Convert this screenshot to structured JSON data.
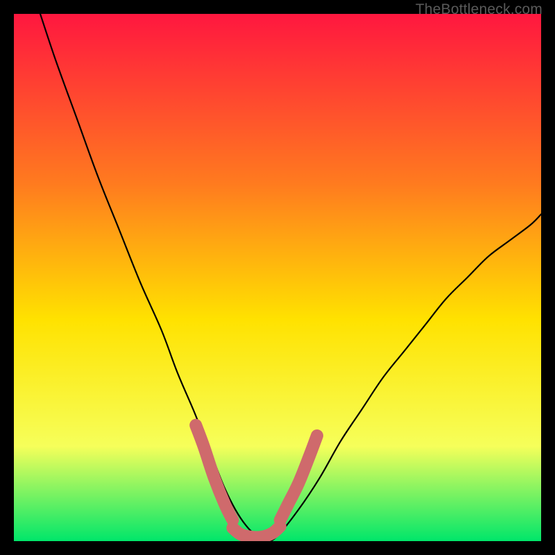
{
  "watermark": "TheBottleneck.com",
  "colors": {
    "frame": "#000000",
    "gradient_top": "#ff173f",
    "gradient_mid1": "#ff7a1f",
    "gradient_mid2": "#ffe200",
    "gradient_mid3": "#f6ff5a",
    "gradient_bottom": "#00e66a",
    "curve": "#000000",
    "highlight": "#cf6a6c"
  },
  "chart_data": {
    "type": "line",
    "title": "",
    "xlabel": "",
    "ylabel": "",
    "xlim": [
      0,
      100
    ],
    "ylim": [
      0,
      100
    ],
    "series": [
      {
        "name": "bottleneck-curve",
        "x": [
          5,
          8,
          12,
          16,
          20,
          24,
          28,
          31,
          34,
          36,
          38,
          40,
          42,
          44,
          46,
          48,
          50,
          54,
          58,
          62,
          66,
          70,
          74,
          78,
          82,
          86,
          90,
          94,
          98,
          100
        ],
        "y": [
          100,
          91,
          80,
          69,
          59,
          49,
          40,
          32,
          25,
          20,
          15,
          10,
          6,
          3,
          1,
          0,
          1,
          6,
          12,
          19,
          25,
          31,
          36,
          41,
          46,
          50,
          54,
          57,
          60,
          62
        ]
      }
    ],
    "highlight_segments": [
      {
        "name": "left-arm",
        "x": [
          34.5,
          36,
          38,
          40,
          41.5
        ],
        "y": [
          22,
          18,
          12,
          7,
          4
        ]
      },
      {
        "name": "valley-floor",
        "x": [
          41.5,
          43,
          45,
          47,
          49,
          50.5
        ],
        "y": [
          2.5,
          1.3,
          0.8,
          0.8,
          1.5,
          2.8
        ]
      },
      {
        "name": "right-arm",
        "x": [
          50.5,
          52,
          54,
          56,
          57.5
        ],
        "y": [
          4,
          7,
          11,
          16,
          20
        ]
      }
    ],
    "annotations": []
  }
}
